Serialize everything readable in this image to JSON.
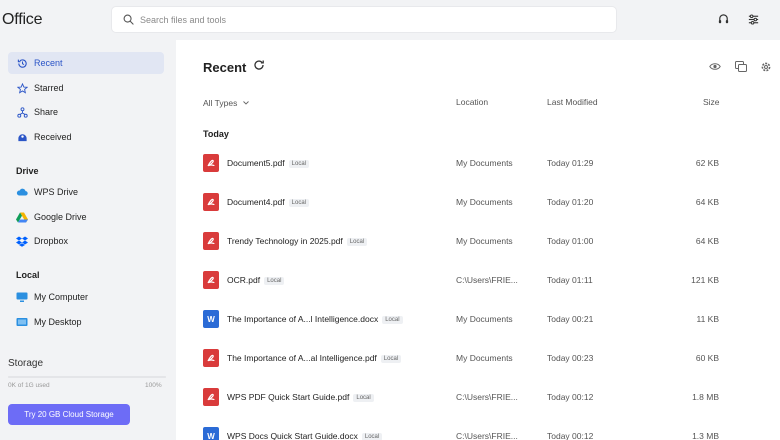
{
  "app": {
    "title": "Office"
  },
  "search": {
    "placeholder": "Search files and tools"
  },
  "sidebar": {
    "items": [
      {
        "label": "Recent",
        "icon": "recent-icon",
        "active": true
      },
      {
        "label": "Starred",
        "icon": "star-icon"
      },
      {
        "label": "Share",
        "icon": "share-icon"
      },
      {
        "label": "Received",
        "icon": "received-icon"
      }
    ],
    "drive_title": "Drive",
    "drive_items": [
      {
        "label": "WPS Drive",
        "icon": "cloud-icon"
      },
      {
        "label": "Google Drive",
        "icon": "google-drive-icon"
      },
      {
        "label": "Dropbox",
        "icon": "dropbox-icon"
      }
    ],
    "local_title": "Local",
    "local_items": [
      {
        "label": "My Computer",
        "icon": "computer-icon"
      },
      {
        "label": "My Desktop",
        "icon": "desktop-icon"
      }
    ],
    "storage": {
      "title": "Storage",
      "used_text": "0K of 1G used",
      "percent_text": "100%",
      "button": "Try 20 GB Cloud Storage"
    }
  },
  "main": {
    "title": "Recent",
    "columns": {
      "type_filter": "All Types",
      "location": "Location",
      "modified": "Last Modified",
      "size": "Size"
    },
    "group": "Today",
    "files": [
      {
        "name": "Document5.pdf",
        "tag": "Local",
        "type": "pdf",
        "location": "My Documents",
        "modified": "Today 01:29",
        "size": "62 KB"
      },
      {
        "name": "Document4.pdf",
        "tag": "Local",
        "type": "pdf",
        "location": "My Documents",
        "modified": "Today 01:20",
        "size": "64 KB"
      },
      {
        "name": "Trendy Technology in 2025.pdf",
        "tag": "Local",
        "type": "pdf",
        "location": "My Documents",
        "modified": "Today 01:00",
        "size": "64 KB"
      },
      {
        "name": "OCR.pdf",
        "tag": "Local",
        "type": "pdf",
        "location": "C:\\Users\\FRIE...",
        "modified": "Today 01:11",
        "size": "121 KB"
      },
      {
        "name": "The Importance of A...l Intelligence.docx",
        "tag": "Local",
        "type": "doc",
        "location": "My Documents",
        "modified": "Today 00:21",
        "size": "11 KB"
      },
      {
        "name": "The Importance of A...al Intelligence.pdf",
        "tag": "Local",
        "type": "pdf",
        "location": "My Documents",
        "modified": "Today 00:23",
        "size": "60 KB"
      },
      {
        "name": "WPS PDF Quick Start Guide.pdf",
        "tag": "Local",
        "type": "pdf",
        "location": "C:\\Users\\FRIE...",
        "modified": "Today 00:12",
        "size": "1.8 MB"
      },
      {
        "name": "WPS Docs Quick Start Guide.docx",
        "tag": "Local",
        "type": "doc",
        "location": "C:\\Users\\FRIE...",
        "modified": "Today 00:12",
        "size": "1.3 MB"
      }
    ]
  },
  "colors": {
    "accent": "#2b55c7",
    "button": "#6d6cf6",
    "pdf": "#d93b3b",
    "doc": "#2b6bd6"
  }
}
